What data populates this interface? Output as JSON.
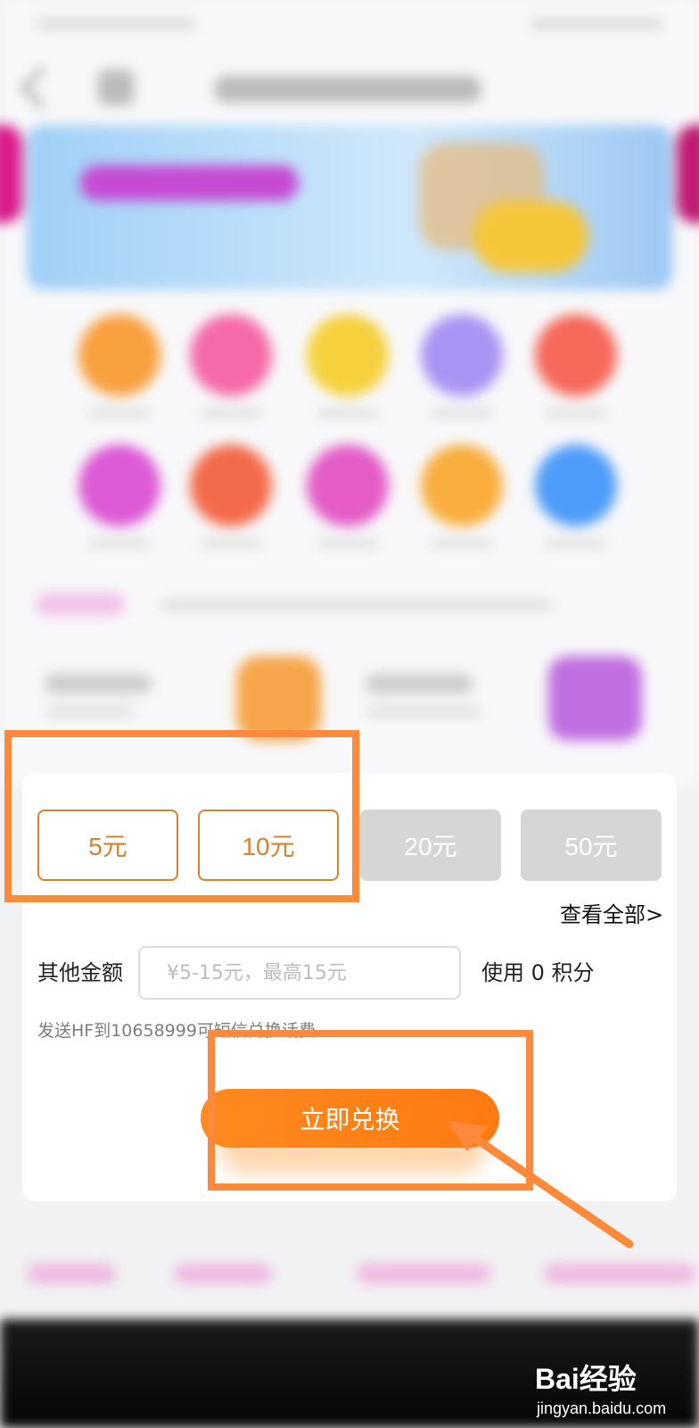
{
  "amounts": [
    {
      "label": "5元",
      "state": "selected"
    },
    {
      "label": "10元",
      "state": "selected"
    },
    {
      "label": "20元",
      "state": "disabled"
    },
    {
      "label": "50元",
      "state": "disabled"
    }
  ],
  "view_all_label": "查看全部>",
  "other_amount": {
    "label": "其他金额",
    "placeholder": "¥5-15元，最高15元",
    "points_text": "使用 0 积分"
  },
  "sms_hint": "发送HF到10658999可短信兑换话费",
  "exchange_button_label": "立即兑换",
  "watermark": {
    "logo_text": "Bai经验",
    "url": "jingyan.baidu.com"
  },
  "colors": {
    "accent_orange": "#d9802f",
    "annotation_orange": "#fd8a3a",
    "button_orange": "#ff8a1f",
    "disabled_gray": "#d6d6d6"
  },
  "blurred_icons": [
    "orange",
    "pink",
    "yellow",
    "purple",
    "red",
    "magenta",
    "coral",
    "pink",
    "orange",
    "blue"
  ]
}
